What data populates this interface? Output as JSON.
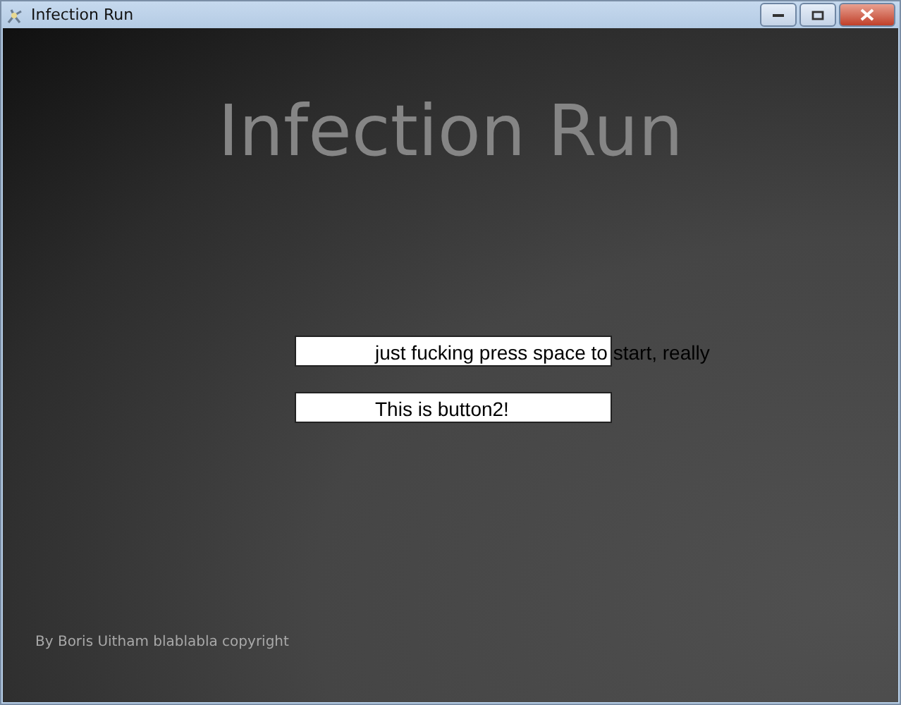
{
  "window": {
    "title": "Infection Run"
  },
  "game": {
    "title": "Infection Run",
    "buttons": [
      {
        "label": "just fucking press space to start, really"
      },
      {
        "label": "This is button2!"
      }
    ],
    "footer": "By Boris Uitham blablabla copyright"
  }
}
